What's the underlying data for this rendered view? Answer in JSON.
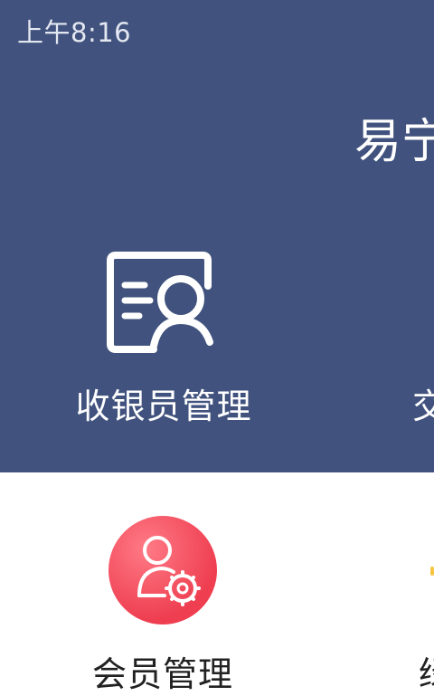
{
  "status_bar": {
    "time": "上午8:16"
  },
  "header": {
    "title": "易宁"
  },
  "menu_top": [
    {
      "label": "收银员管理",
      "icon": "cashier-profile-icon"
    },
    {
      "label": "交"
    }
  ],
  "menu_bottom": [
    {
      "label": "会员管理",
      "icon": "member-settings-icon"
    },
    {
      "label": "绿"
    }
  ],
  "colors": {
    "header_bg": "#40527d",
    "member_icon": "#ee3e50"
  }
}
